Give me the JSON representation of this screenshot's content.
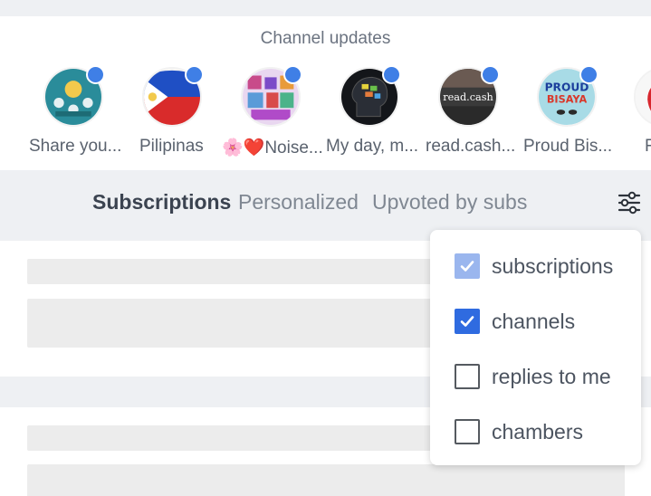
{
  "channel_updates": {
    "title": "Channel updates",
    "channels": [
      {
        "label": "Share you...",
        "icon": "community-icon"
      },
      {
        "label": "Pilipinas",
        "icon": "philippines-flag-icon"
      },
      {
        "label": "🌸❤️Noise...",
        "icon": "collage-icon"
      },
      {
        "label": "My day, m...",
        "icon": "head-notes-icon"
      },
      {
        "label": "read.cash...",
        "icon": "readcash-icon"
      },
      {
        "label": "Proud Bis...",
        "icon": "proud-bisaya-icon"
      },
      {
        "label": "F",
        "icon": "strawberry-icon"
      }
    ]
  },
  "feed_tabs": {
    "subscriptions": "Subscriptions",
    "personalized": "Personalized",
    "upvoted": "Upvoted by subs",
    "filter_icon": "sliders-icon"
  },
  "filter_menu": {
    "options": [
      {
        "label": "subscriptions",
        "checked": true,
        "disabled": true
      },
      {
        "label": "channels",
        "checked": true,
        "disabled": false
      },
      {
        "label": "replies to me",
        "checked": false,
        "disabled": false
      },
      {
        "label": "chambers",
        "checked": false,
        "disabled": false
      }
    ]
  },
  "colors": {
    "accent": "#2f6be0",
    "notification_dot": "#3f7fe6",
    "background": "#eef0f3"
  }
}
